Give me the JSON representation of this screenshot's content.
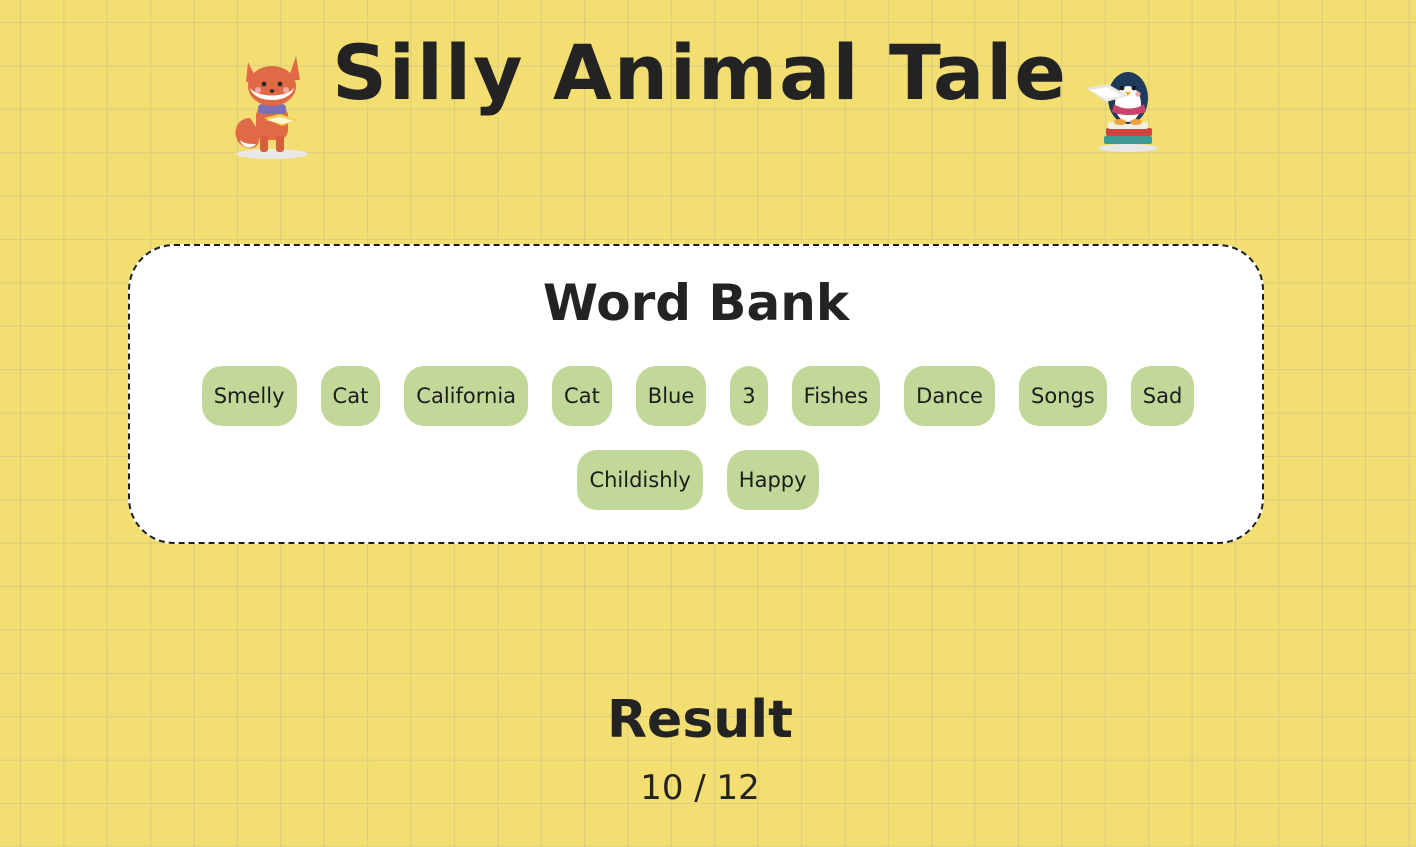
{
  "header": {
    "title": "Silly Animal Tale",
    "left_mascot": "fox-reading-icon",
    "right_mascot": "penguin-reading-icon"
  },
  "word_bank": {
    "title": "Word Bank",
    "words": [
      "Smelly",
      "Cat",
      "California",
      "Cat",
      "Blue",
      "3",
      "Fishes",
      "Dance",
      "Songs",
      "Sad",
      "Childishly",
      "Happy"
    ]
  },
  "result": {
    "title": "Result",
    "score": "10 / 12"
  },
  "colors": {
    "background": "#f3de72",
    "chip": "#c2d898",
    "panel": "#ffffff",
    "text": "#232323"
  }
}
